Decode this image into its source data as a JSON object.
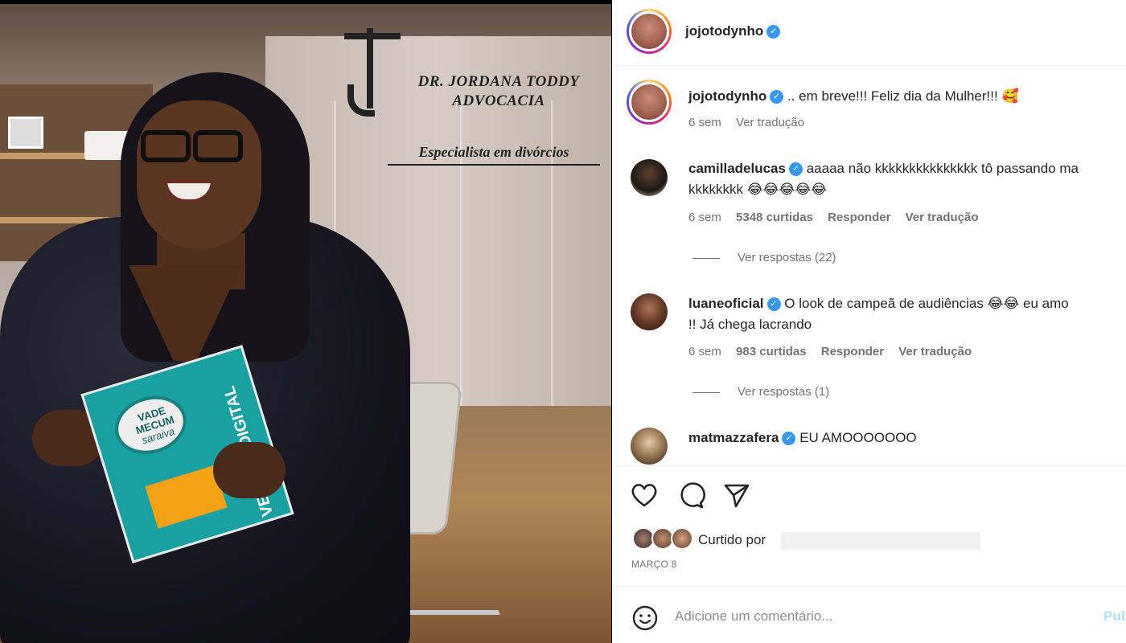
{
  "post_image": {
    "logo_name_line1": "DR. JORDANA TODDY",
    "logo_name_line2": "ADVOCACIA",
    "tagline": "Especialista em divórcios",
    "book_title_line1": "VADE",
    "book_title_line2": "MECUM",
    "book_title_line3": "saraiva",
    "book_side_text": "VERSÃO DIGITAL"
  },
  "header": {
    "username": "jojotodynho",
    "verified": true
  },
  "caption": {
    "username": "jojotodynho",
    "text": ".. em breve!!! Feliz dia da Mulher!!! 🥰",
    "time": "6 sem",
    "translate": "Ver tradução"
  },
  "comments": [
    {
      "username": "camilladelucas",
      "text_line1": "aaaaa não kkkkkkkkkkkkkkk tô passando ma",
      "text_line2": "kkkkkkkk 😂😂😂😂😂",
      "time": "6 sem",
      "likes": "5348 curtidas",
      "reply": "Responder",
      "translate": "Ver tradução",
      "replies": "Ver respostas (22)"
    },
    {
      "username": "luaneoficial",
      "text_line1": "O look de campeã de audiências 😂😂 eu amo",
      "text_line2": "!! Já chega lacrando",
      "time": "6 sem",
      "likes": "983 curtidas",
      "reply": "Responder",
      "translate": "Ver tradução",
      "replies": "Ver respostas (1)"
    },
    {
      "username": "matmazzafera",
      "text_line1": "EU AMOOOOOOO"
    }
  ],
  "actions": {
    "like_icon": "heart-icon",
    "comment_icon": "comment-icon",
    "share_icon": "paper-plane-icon"
  },
  "likes": {
    "liked_by": "Curtido por"
  },
  "date": "MARÇO 8",
  "add_comment": {
    "emoji_icon": "smiley-icon",
    "placeholder": "Adicione um comentário...",
    "publish": "Pub"
  },
  "colors": {
    "verified": "#3897f0",
    "muted": "#737373",
    "publish_disabled": "#b2dffc"
  }
}
